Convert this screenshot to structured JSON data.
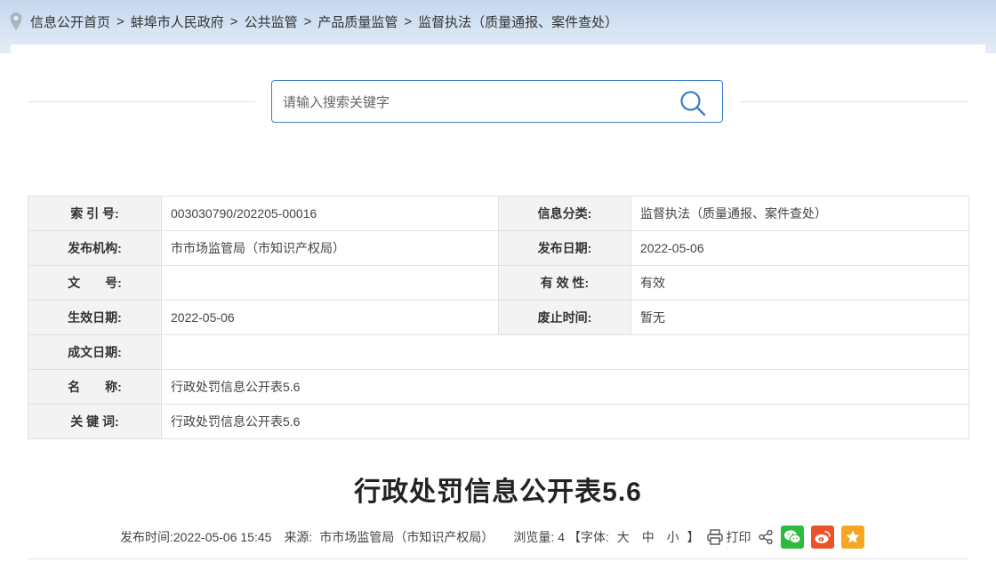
{
  "breadcrumb": {
    "items": [
      "信息公开首页",
      "蚌埠市人民政府",
      "公共监管",
      "产品质量监管",
      "监督执法（质量通报、案件查处）"
    ],
    "separator": ">"
  },
  "search": {
    "placeholder": "请输入搜索关键字",
    "value": ""
  },
  "meta": {
    "index_label": "索 引 号:",
    "index_value": "003030790/202205-00016",
    "category_label": "信息分类:",
    "category_value": "监督执法（质量通报、案件查处）",
    "publisher_label": "发布机构:",
    "publisher_value": "市市场监管局（市知识产权局）",
    "pubdate_label": "发布日期:",
    "pubdate_value": "2022-05-06",
    "docno_label": "文　　号:",
    "docno_value": "",
    "validity_label": "有 效 性:",
    "validity_value": "有效",
    "effective_label": "生效日期:",
    "effective_value": "2022-05-06",
    "abolish_label": "废止时间:",
    "abolish_value": "暂无",
    "written_label": "成文日期:",
    "written_value": "",
    "name_label": "名　　称:",
    "name_value": "行政处罚信息公开表5.6",
    "keywords_label": "关 键 词:",
    "keywords_value": "行政处罚信息公开表5.6"
  },
  "article": {
    "title": "行政处罚信息公开表5.6",
    "publish_time_label": "发布时间:",
    "publish_time": "2022-05-06 15:45",
    "source_label": "来源:",
    "source": "市市场监管局（市知识产权局）",
    "views_label": "浏览量:",
    "views": "4",
    "font_open": "【字体:",
    "font_large": "大",
    "font_medium": "中",
    "font_small": "小",
    "font_close": "】",
    "print_label": "打印"
  },
  "icons": {
    "location": "location-pin-icon",
    "search": "search-icon",
    "print": "printer-icon",
    "share": "share-icon",
    "wechat": "wechat-icon",
    "weibo": "weibo-icon",
    "favorite": "star-icon"
  },
  "colors": {
    "accent": "#3c7fc6",
    "wechat": "#2dbb3d",
    "weibo": "#e8532b",
    "favorite": "#f5a623"
  }
}
